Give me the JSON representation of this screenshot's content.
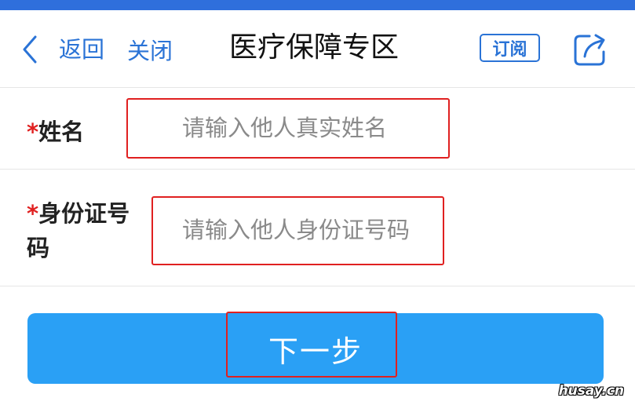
{
  "colors": {
    "top_bar": "#2f6fdc",
    "link_blue": "#2a73d6",
    "primary_button": "#2aa0f5",
    "highlight_red": "#e02020",
    "required_red": "#e02020"
  },
  "navbar": {
    "back_label": "返回",
    "close_label": "关闭",
    "title": "医疗保障专区",
    "subscribe_label": "订阅",
    "back_icon": "chevron-left-icon",
    "share_icon": "share-icon"
  },
  "form": {
    "name": {
      "required_mark": "*",
      "label": "姓名",
      "placeholder": "请输入他人真实姓名",
      "value": ""
    },
    "id_number": {
      "required_mark": "*",
      "label": "身份证号码",
      "placeholder": "请输入他人身份证号码",
      "value": ""
    }
  },
  "actions": {
    "next_label": "下一步"
  },
  "watermark": "husay.cn"
}
